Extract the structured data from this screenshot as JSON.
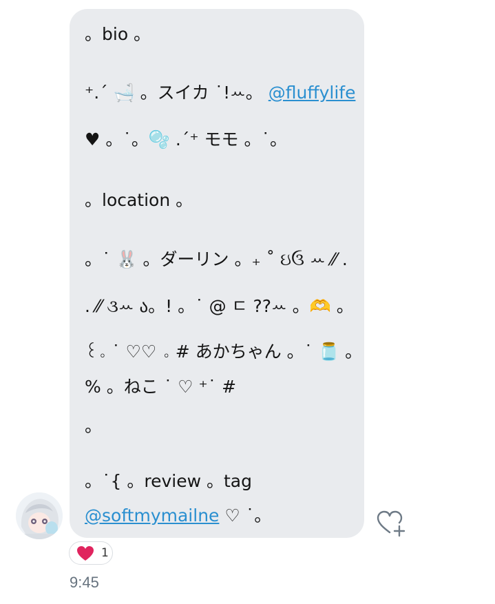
{
  "message": {
    "lines": [
      "。bio 。",
      "⁺.ˊ 🛁 。スイカ ˙!ꕀ。",
      "♥︎ 。˙。🫧 .ˊ⁺ モモ 。˙。",
      "。location 。",
      "。˙ 🐰 。ダーリン 。₊ ˚ ઇઉ ꕀ ⁄⁄ .",
      ". ⁄⁄ ૩ꕀ ა。! 。˙ @ ㄷ ??ꕀ 。🫶 。",
      "꒰。˙ ♡♡ 。# あかちゃん 。˙ 🫙 。",
      "% 。ねこ ˙ ♡ ⁺˙ #",
      "。",
      "。˙{ 。review 。tag",
      "♡ ˙。"
    ],
    "mention_1": "@fluffylife",
    "mention_2": "@softmymailne"
  },
  "reaction": {
    "emoji": "heart",
    "count": "1"
  },
  "timestamp": "9:45",
  "colors": {
    "bubble": "#e9ebee",
    "mention": "#2a8fd0",
    "heart": "#e0245e",
    "icon_gray": "#6e7a86",
    "timestamp": "#66727e"
  },
  "icons": {
    "add_reaction": "heart-plus-icon",
    "reaction": "heart-icon"
  }
}
